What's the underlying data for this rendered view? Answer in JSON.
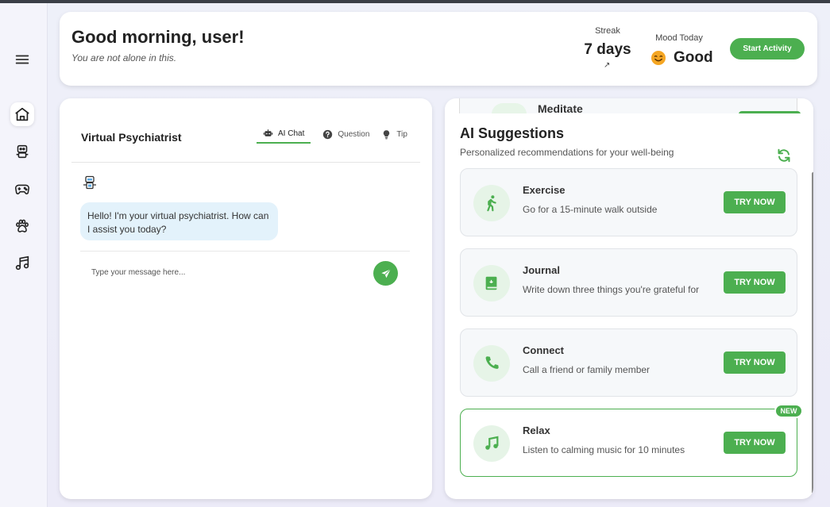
{
  "colors": {
    "accent": "#4caf50",
    "bubble": "#e3f2fb",
    "icon_bg": "#e6f4e7"
  },
  "sidebar": {
    "items": [
      {
        "icon": "menu-icon"
      },
      {
        "icon": "home-icon",
        "active": true
      },
      {
        "icon": "robot-icon"
      },
      {
        "icon": "gamepad-icon"
      },
      {
        "icon": "paw-icon"
      },
      {
        "icon": "music-icon"
      }
    ]
  },
  "header": {
    "greeting": "Good morning, user!",
    "subtitle": "You are not alone in this.",
    "streak_label": "Streak",
    "streak_value": "7 days",
    "streak_trend": "↗",
    "mood_label": "Mood Today",
    "mood_emoji": "smiling-face-icon",
    "mood_value": "Good",
    "start_button": "Start Activity"
  },
  "chat": {
    "title": "Virtual Psychiatrist",
    "tabs": [
      {
        "label": "AI Chat",
        "icon": "robot-icon",
        "active": true
      },
      {
        "label": "Question",
        "icon": "question-circle-icon"
      },
      {
        "label": "Tip",
        "icon": "lightbulb-icon"
      }
    ],
    "messages": [
      {
        "from": "bot",
        "text": "Hello! I'm your virtual psychiatrist. How can I assist you today?"
      }
    ],
    "input_placeholder": "Type your message here..."
  },
  "suggestions": {
    "peek_item": "Meditate",
    "title": "AI Suggestions",
    "subtitle": "Personalized recommendations for your well-being",
    "items": [
      {
        "name": "Exercise",
        "desc": "Go for a 15-minute walk outside",
        "icon": "walking-icon",
        "button": "TRY NOW"
      },
      {
        "name": "Journal",
        "desc": "Write down three things you're grateful for",
        "icon": "journal-icon",
        "button": "TRY NOW"
      },
      {
        "name": "Connect",
        "desc": "Call a friend or family member",
        "icon": "phone-icon",
        "button": "TRY NOW"
      },
      {
        "name": "Relax",
        "desc": "Listen to calming music for 10 minutes",
        "icon": "music-icon",
        "button": "TRY NOW",
        "badge": "NEW"
      }
    ]
  }
}
